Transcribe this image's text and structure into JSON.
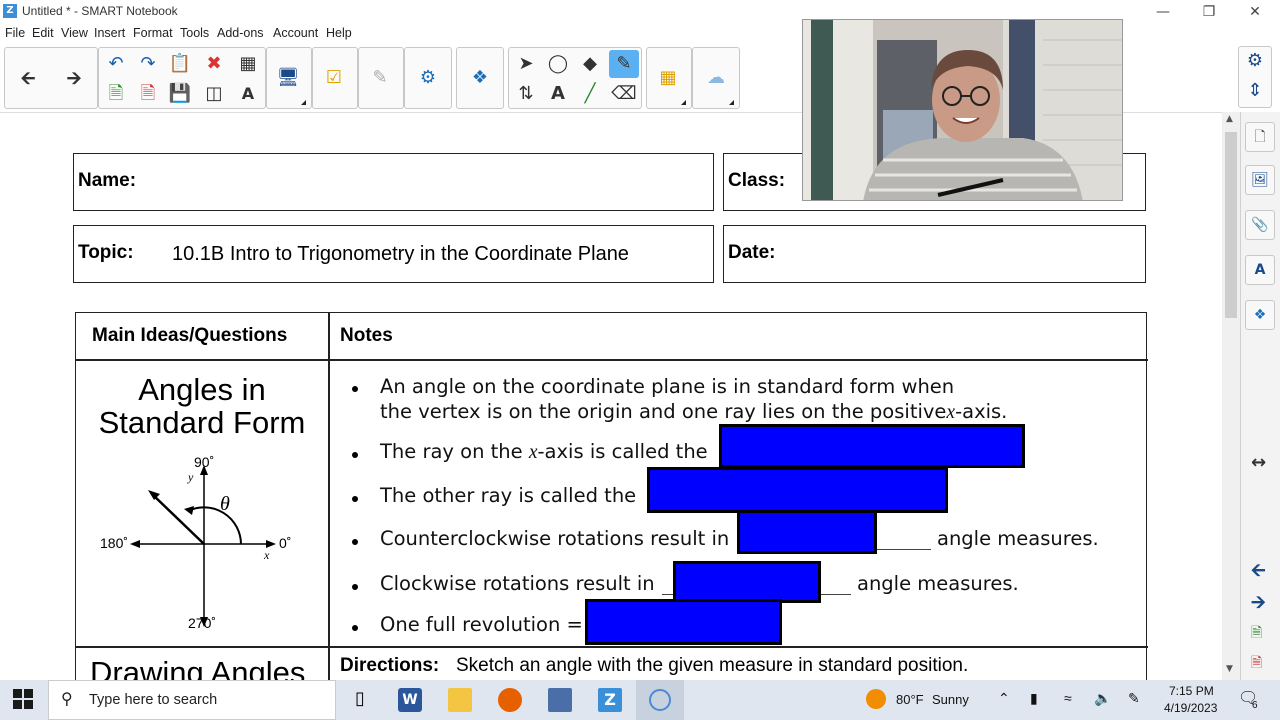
{
  "window": {
    "title": "Untitled * - SMART Notebook",
    "logo_letter": "Z"
  },
  "menu": [
    "File",
    "Edit",
    "View",
    "Insert",
    "Format",
    "Tools",
    "Add-ons",
    "Account",
    "Help"
  ],
  "worksheet": {
    "name_label": "Name:",
    "class_label": "Class:",
    "topic_label": "Topic:",
    "topic_value": "10.1B Intro to Trigonometry in the Coordinate Plane",
    "date_label": "Date:",
    "col_main": "Main Ideas/Questions",
    "col_notes": "Notes",
    "section_title_1": "Angles in",
    "section_title_2": "Standard Form",
    "diagram": {
      "top": "90˚",
      "left": "180˚",
      "right": "0˚",
      "bottom": "270˚",
      "ylabel": "y",
      "xlabel": "x",
      "theta": "θ"
    },
    "bullets": {
      "b1_line1": "An angle on the coordinate plane is in standard form when",
      "b1_line2": "the vertex is on the origin and one ray lies on the positive",
      "b1_x": "x",
      "b1_tail": "-axis.",
      "b2_pre": "The ray on the ",
      "b2_x": "x",
      "b2_post": "-axis is called the",
      "b3": "The other ray is called the",
      "b4_pre": "Counterclockwise rotations result in",
      "b4_post": "angle measures.",
      "b5_pre": "Clockwise rotations result in",
      "b5_post": "angle measures.",
      "b6": "One full revolution ="
    },
    "section2_title": "Drawing Angles",
    "directions_label": "Directions:",
    "directions_text": "Sketch an angle with the given measure in standard position."
  },
  "taskbar": {
    "search_placeholder": "Type here to search",
    "weather_temp": "80°F",
    "weather_cond": "Sunny",
    "time": "7:15 PM",
    "date": "4/19/2023",
    "notification_count": "6"
  },
  "colors": {
    "highlight_blue": "#0000ff",
    "accent": "#3a8fd9",
    "taskbar": "#dfe6ef"
  }
}
